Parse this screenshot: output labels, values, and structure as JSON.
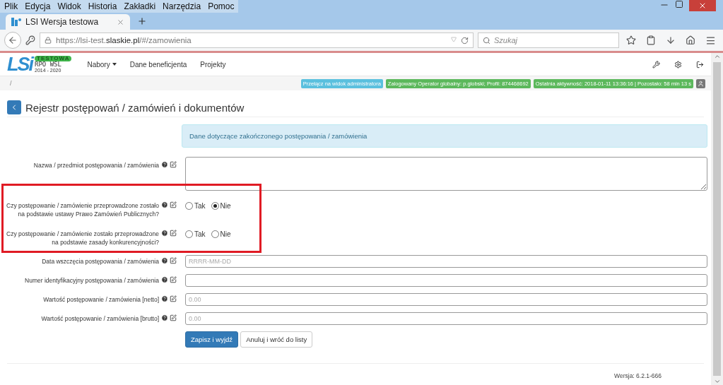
{
  "browser": {
    "menu": [
      "Plik",
      "Edycja",
      "Widok",
      "Historia",
      "Zakładki",
      "Narzędzia",
      "Pomoc"
    ],
    "tab": {
      "title": "LSI Wersja testowa"
    },
    "url": {
      "prefix": "https://lsi-test.",
      "domain": "slaskie.pl",
      "path": "/#/zamowienia"
    },
    "search": {
      "placeholder": "Szukaj"
    }
  },
  "app": {
    "logo": {
      "mark": "LSi",
      "badge": "TESTOWA",
      "line1": "RPO WSL",
      "line2": "2014 - 2020"
    },
    "nav": [
      {
        "label": "Nabory",
        "dropdown": true
      },
      {
        "label": "Dane beneficjenta",
        "dropdown": false
      },
      {
        "label": "Projekty",
        "dropdown": false
      }
    ]
  },
  "breadcrumb": "/",
  "badges": [
    {
      "text": "Przełącz na widok administratora",
      "color": "#5bc0de"
    },
    {
      "text": "Zalogowany Operator globalny: p.globski; Profil: 874468692",
      "color": "#5cb85c"
    },
    {
      "text": "Ostatnia aktywność: 2018-01-11 13:36:16 | Pozostało: 58 min 13 s",
      "color": "#5cb85c"
    }
  ],
  "page_title": "Rejestr postępowań / zamówień i dokumentów",
  "section_heading": "Dane dotyczące zakończonego postępowania / zamówienia",
  "fields": [
    {
      "kind": "textarea",
      "label": "Nazwa / przedmiot postępowania / zamówienia",
      "highlighted": false
    },
    {
      "kind": "radio",
      "label": "Czy postępowanie / zamówienie przeprowadzone zostało na podstawie ustawy Prawo Zamówień Publicznych?",
      "highlighted": true,
      "options": [
        {
          "label": "Tak",
          "selected": false
        },
        {
          "label": "Nie",
          "selected": true
        }
      ]
    },
    {
      "kind": "radio",
      "label": "Czy postępowanie / zamówienie zostało przeprowadzone na podstawie zasady konkurencyjności?",
      "highlighted": true,
      "options": [
        {
          "label": "Tak",
          "selected": false
        },
        {
          "label": "Nie",
          "selected": false
        }
      ]
    },
    {
      "kind": "input",
      "label": "Data wszczęcia postępowania / zamówienia",
      "placeholder": "RRRR-MM-DD",
      "highlighted": false
    },
    {
      "kind": "input",
      "label": "Numer identyfikacyjny postępowania / zamówienia",
      "highlighted": false
    },
    {
      "kind": "input",
      "label": "Wartość postępowanie / zamówienia [netto]",
      "placeholder": "0.00",
      "highlighted": false
    },
    {
      "kind": "input",
      "label": "Wartość postępowanie / zamówienia [brutto]",
      "placeholder": "0.00",
      "highlighted": false
    }
  ],
  "buttons": [
    {
      "kind": "primary",
      "label": "Zapisz i wyjdź"
    },
    {
      "kind": "default",
      "label": "Anuluj i wróć do listy"
    }
  ],
  "footer": "Wersja: 6.2.1-666"
}
